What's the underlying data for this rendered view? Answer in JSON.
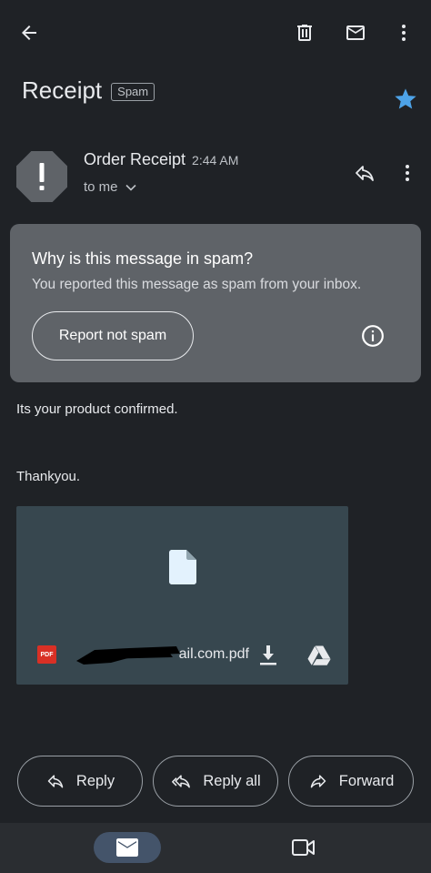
{
  "email": {
    "subject": "Receipt",
    "label": "Spam",
    "sender": "Order Receipt",
    "time": "2:44 AM",
    "recipient": "to me",
    "body": [
      "Its your product confirmed.",
      "Thankyou."
    ]
  },
  "spam_notice": {
    "title": "Why is this message in spam?",
    "description": "You reported this message as spam from your inbox.",
    "button_label": "Report not spam"
  },
  "attachment": {
    "file_name_visible": "ail.com.pdf",
    "type_badge": "PDF"
  },
  "actions": {
    "reply": "Reply",
    "reply_all": "Reply all",
    "forward": "Forward"
  },
  "icons": {
    "back": "arrow-back-icon",
    "delete": "trash-icon",
    "mark_unread": "mail-icon",
    "more": "more-vert-icon",
    "star": "star-icon",
    "alert": "alert-octagon-icon",
    "reply": "reply-icon",
    "info": "info-icon",
    "download": "download-icon",
    "drive": "drive-icon",
    "meet": "video-icon"
  },
  "colors": {
    "background": "#1f2226",
    "spam_card": "#5f6368",
    "attachment_bg": "#37474f",
    "star": "#4da3e8",
    "nav_active": "#44546a",
    "pdf_red": "#d93025"
  }
}
